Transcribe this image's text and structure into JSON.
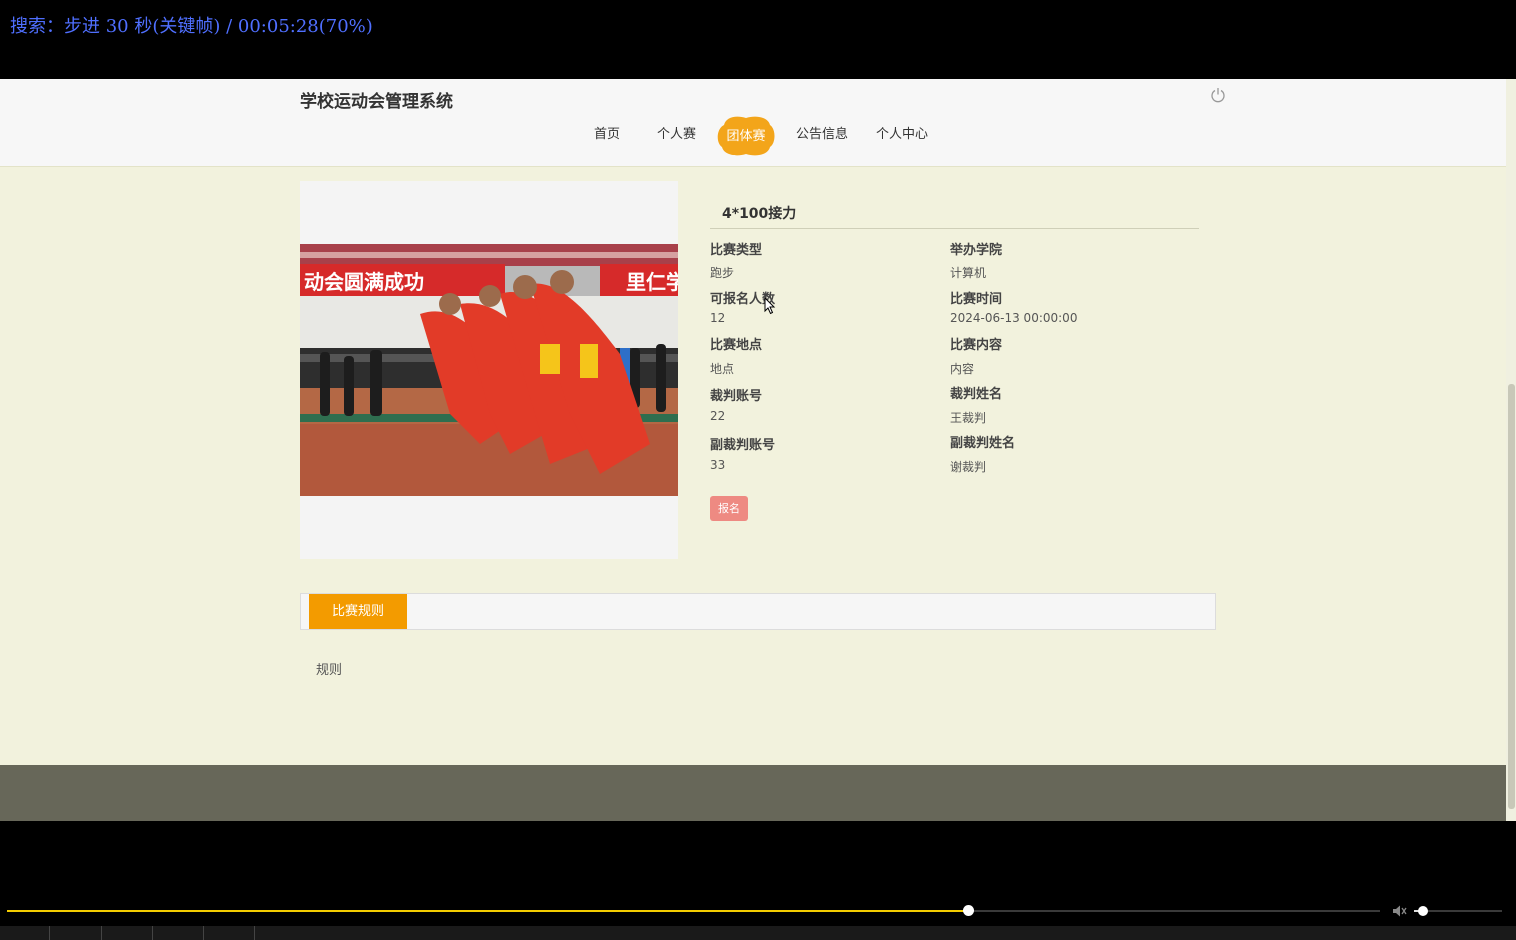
{
  "osd": {
    "text": "搜索：步进 30 秒(关键帧) / 00:05:28(70%)"
  },
  "site": {
    "title": "学校运动会管理系统"
  },
  "nav": {
    "items": [
      {
        "label": "首页"
      },
      {
        "label": "个人赛"
      },
      {
        "label": "团体赛"
      },
      {
        "label": "公告信息"
      },
      {
        "label": "个人中心"
      }
    ],
    "active_index": 2,
    "active_color": "#f3a51a"
  },
  "detail": {
    "title": "4*100接力",
    "fields": [
      {
        "label": "比赛类型",
        "value": "跑步"
      },
      {
        "label": "举办学院",
        "value": "计算机"
      },
      {
        "label": "可报名人数",
        "value": "12"
      },
      {
        "label": "比赛时间",
        "value": "2024-06-13 00:00:00"
      },
      {
        "label": "比赛地点",
        "value": "地点"
      },
      {
        "label": "比赛内容",
        "value": "内容"
      },
      {
        "label": "裁判账号",
        "value": "22"
      },
      {
        "label": "裁判姓名",
        "value": "王裁判"
      },
      {
        "label": "副裁判账号",
        "value": "33"
      },
      {
        "label": "副裁判姓名",
        "value": "谢裁判"
      }
    ],
    "signup_label": "报名",
    "photo_banner_left": "动会圆满成功",
    "photo_banner_right": "里仁学"
  },
  "tabs": {
    "active_label": "比赛规则",
    "content": "规则"
  },
  "player": {
    "progress_fraction": 0.7,
    "volume_fraction": 0.1,
    "accent": "#f3cc00"
  }
}
